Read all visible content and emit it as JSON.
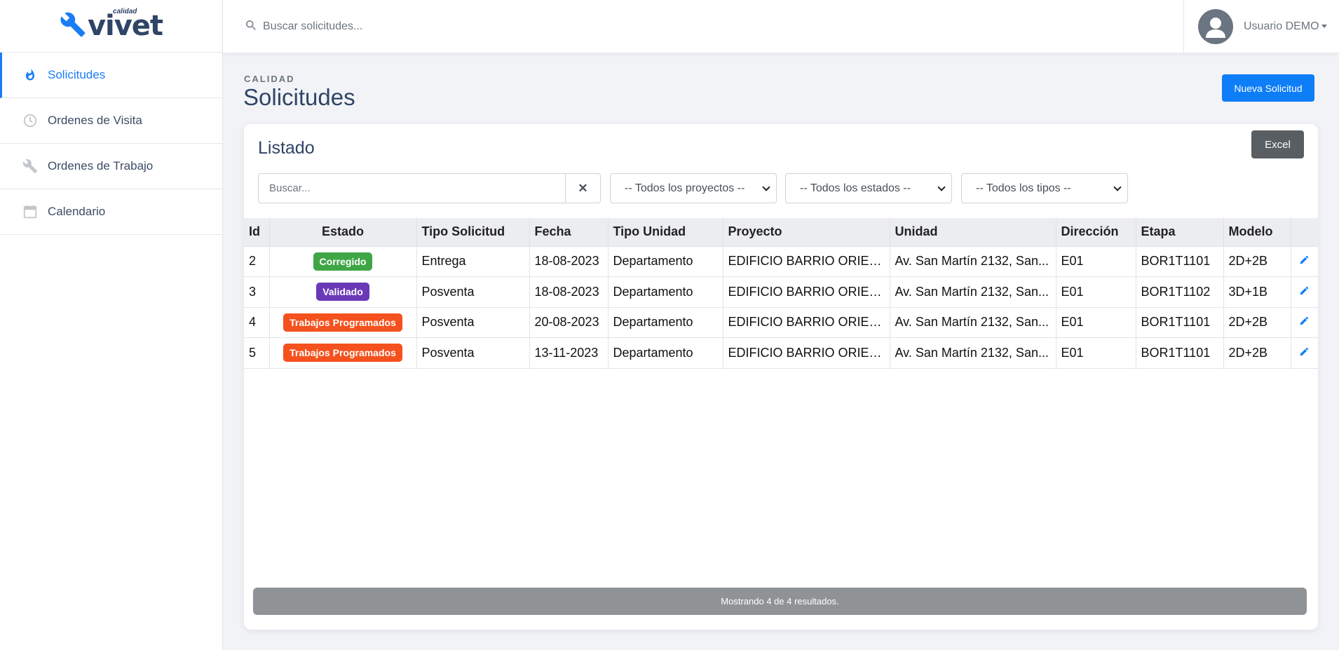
{
  "logo": {
    "main": "vivet",
    "small": "calidad"
  },
  "sidebar": {
    "items": [
      {
        "label": "Solicitudes",
        "icon": "fire-icon",
        "active": true
      },
      {
        "label": "Ordenes de Visita",
        "icon": "clock-icon",
        "active": false
      },
      {
        "label": "Ordenes de Trabajo",
        "icon": "wrench-icon",
        "active": false
      },
      {
        "label": "Calendario",
        "icon": "calendar-icon",
        "active": false
      }
    ]
  },
  "topbar": {
    "search_placeholder": "Buscar solicitudes...",
    "user_name": "Usuario DEMO"
  },
  "header": {
    "overline": "CALIDAD",
    "title": "Solicitudes",
    "new_button": "Nueva Solicitud"
  },
  "card": {
    "title": "Listado",
    "excel_button": "Excel",
    "search_placeholder": "Buscar...",
    "clear_symbol": "✕",
    "filters": {
      "projects": "-- Todos los proyectos --",
      "states": "-- Todos los estados --",
      "types": "-- Todos los tipos --"
    }
  },
  "table": {
    "columns": [
      "Id",
      "Estado",
      "Tipo Solicitud",
      "Fecha",
      "Tipo Unidad",
      "Proyecto",
      "Unidad",
      "Dirección",
      "Etapa",
      "Modelo"
    ],
    "rows": [
      {
        "id": "2",
        "estado": "Corregido",
        "estado_color": "#3fa646",
        "tipo": "Entrega",
        "fecha": "18-08-2023",
        "tipo_unidad": "Departamento",
        "proyecto": "EDIFICIO BARRIO ORIEN...",
        "unidad": "Av. San Martín 2132, San...",
        "direccion": "E01",
        "etapa": "BOR1T1101",
        "modelo": "2D+2B"
      },
      {
        "id": "3",
        "estado": "Validado",
        "estado_color": "#6a39b8",
        "tipo": "Posventa",
        "fecha": "18-08-2023",
        "tipo_unidad": "Departamento",
        "proyecto": "EDIFICIO BARRIO ORIEN...",
        "unidad": "Av. San Martín 2132, San...",
        "direccion": "E01",
        "etapa": "BOR1T1102",
        "modelo": "3D+1B"
      },
      {
        "id": "4",
        "estado": "Trabajos Programados",
        "estado_color": "#f4511e",
        "tipo": "Posventa",
        "fecha": "20-08-2023",
        "tipo_unidad": "Departamento",
        "proyecto": "EDIFICIO BARRIO ORIEN...",
        "unidad": "Av. San Martín 2132, San...",
        "direccion": "E01",
        "etapa": "BOR1T1101",
        "modelo": "2D+2B"
      },
      {
        "id": "5",
        "estado": "Trabajos Programados",
        "estado_color": "#f4511e",
        "tipo": "Posventa",
        "fecha": "13-11-2023",
        "tipo_unidad": "Departamento",
        "proyecto": "EDIFICIO BARRIO ORIEN...",
        "unidad": "Av. San Martín 2132, San...",
        "direccion": "E01",
        "etapa": "BOR1T1101",
        "modelo": "2D+2B"
      }
    ]
  },
  "footer": {
    "summary": "Mostrando 4 de 4 resultados."
  },
  "colors": {
    "accent": "#0d7df8",
    "brand": "#2f4466",
    "excel": "#595e63"
  }
}
